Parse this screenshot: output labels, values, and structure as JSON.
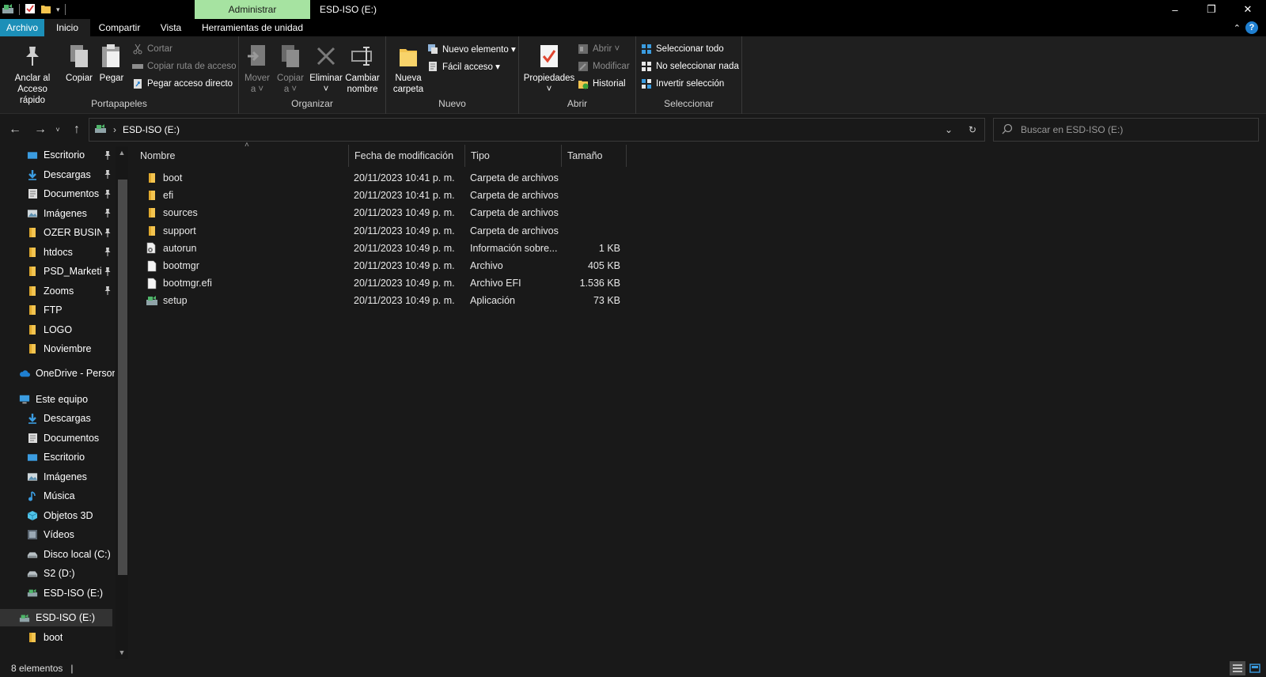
{
  "window": {
    "title": "ESD-ISO (E:)",
    "contextual_tab_group": "Administrar",
    "minimize": "–",
    "maximize": "❐",
    "close": "✕"
  },
  "tabs": [
    {
      "label": "Archivo"
    },
    {
      "label": "Inicio"
    },
    {
      "label": "Compartir"
    },
    {
      "label": "Vista"
    },
    {
      "label": "Herramientas de unidad"
    }
  ],
  "ribbon": {
    "portapapeles": {
      "label": "Portapapeles",
      "anclar": "Anclar al\nAcceso rápido",
      "copiar": "Copiar",
      "pegar": "Pegar",
      "cortar": "Cortar",
      "copiar_ruta": "Copiar ruta de acceso",
      "pegar_acceso": "Pegar acceso directo"
    },
    "organizar": {
      "label": "Organizar",
      "mover": "Mover\na ˅",
      "copiar_a": "Copiar\na ˅",
      "eliminar": "Eliminar\n˅",
      "cambiar_nombre": "Cambiar\nnombre"
    },
    "nuevo": {
      "label": "Nuevo",
      "nueva_carpeta": "Nueva\ncarpeta",
      "nuevo_elemento": "Nuevo elemento ▾",
      "facil_acceso": "Fácil acceso ▾"
    },
    "abrir": {
      "label": "Abrir",
      "propiedades": "Propiedades\n˅",
      "abrir": "Abrir ˅",
      "modificar": "Modificar",
      "historial": "Historial"
    },
    "seleccionar": {
      "label": "Seleccionar",
      "todo": "Seleccionar todo",
      "nada": "No seleccionar nada",
      "invertir": "Invertir selección"
    }
  },
  "address": {
    "path": "ESD-ISO (E:)",
    "search_placeholder": "Buscar en ESD-ISO (E:)"
  },
  "nav_pane": {
    "quick_access": [
      {
        "label": "Escritorio",
        "icon": "desktop-icon",
        "pinned": true
      },
      {
        "label": "Descargas",
        "icon": "download-icon",
        "pinned": true
      },
      {
        "label": "Documentos",
        "icon": "document-icon",
        "pinned": true
      },
      {
        "label": "Imágenes",
        "icon": "picture-icon",
        "pinned": true
      },
      {
        "label": "OZER BUSINE",
        "icon": "folder-icon",
        "pinned": true
      },
      {
        "label": "htdocs",
        "icon": "folder-icon",
        "pinned": true
      },
      {
        "label": "PSD_Marketin",
        "icon": "folder-icon",
        "pinned": true
      },
      {
        "label": "Zooms",
        "icon": "folder-icon",
        "pinned": true
      },
      {
        "label": "FTP",
        "icon": "folder-icon",
        "pinned": false
      },
      {
        "label": "LOGO",
        "icon": "folder-icon",
        "pinned": false
      },
      {
        "label": "Noviembre",
        "icon": "folder-icon",
        "pinned": false
      }
    ],
    "onedrive": "OneDrive - Person",
    "este_equipo": "Este equipo",
    "this_pc_items": [
      {
        "label": "Descargas",
        "icon": "download-icon"
      },
      {
        "label": "Documentos",
        "icon": "document-icon"
      },
      {
        "label": "Escritorio",
        "icon": "desktop-icon"
      },
      {
        "label": "Imágenes",
        "icon": "picture-icon"
      },
      {
        "label": "Música",
        "icon": "music-icon"
      },
      {
        "label": "Objetos 3D",
        "icon": "cube-icon"
      },
      {
        "label": "Vídeos",
        "icon": "video-icon"
      },
      {
        "label": "Disco local (C:)",
        "icon": "drive-icon"
      },
      {
        "label": "S2 (D:)",
        "icon": "drive-icon"
      },
      {
        "label": "ESD-ISO (E:)",
        "icon": "usb-drive-icon"
      }
    ],
    "selected_drive": "ESD-ISO (E:)",
    "boot_folder": "boot"
  },
  "columns": {
    "name": "Nombre",
    "modified": "Fecha de modificación",
    "type": "Tipo",
    "size": "Tamaño"
  },
  "files": [
    {
      "name": "boot",
      "modified": "20/11/2023 10:41 p. m.",
      "type": "Carpeta de archivos",
      "size": "",
      "icon": "folder-icon"
    },
    {
      "name": "efi",
      "modified": "20/11/2023 10:41 p. m.",
      "type": "Carpeta de archivos",
      "size": "",
      "icon": "folder-icon"
    },
    {
      "name": "sources",
      "modified": "20/11/2023 10:49 p. m.",
      "type": "Carpeta de archivos",
      "size": "",
      "icon": "folder-icon"
    },
    {
      "name": "support",
      "modified": "20/11/2023 10:49 p. m.",
      "type": "Carpeta de archivos",
      "size": "",
      "icon": "folder-icon"
    },
    {
      "name": "autorun",
      "modified": "20/11/2023 10:49 p. m.",
      "type": "Información sobre...",
      "size": "1 KB",
      "icon": "settings-file-icon"
    },
    {
      "name": "bootmgr",
      "modified": "20/11/2023 10:49 p. m.",
      "type": "Archivo",
      "size": "405 KB",
      "icon": "file-icon"
    },
    {
      "name": "bootmgr.efi",
      "modified": "20/11/2023 10:49 p. m.",
      "type": "Archivo EFI",
      "size": "1.536 KB",
      "icon": "file-icon"
    },
    {
      "name": "setup",
      "modified": "20/11/2023 10:49 p. m.",
      "type": "Aplicación",
      "size": "73 KB",
      "icon": "setup-app-icon"
    }
  ],
  "status": {
    "count": "8 elementos",
    "separator": "|"
  },
  "colors": {
    "folder": "#f3c44f",
    "archivo_tab": "#1c8fb8",
    "contextual_tab": "#a6e3a1",
    "accent_blue": "#3b9ce0"
  }
}
